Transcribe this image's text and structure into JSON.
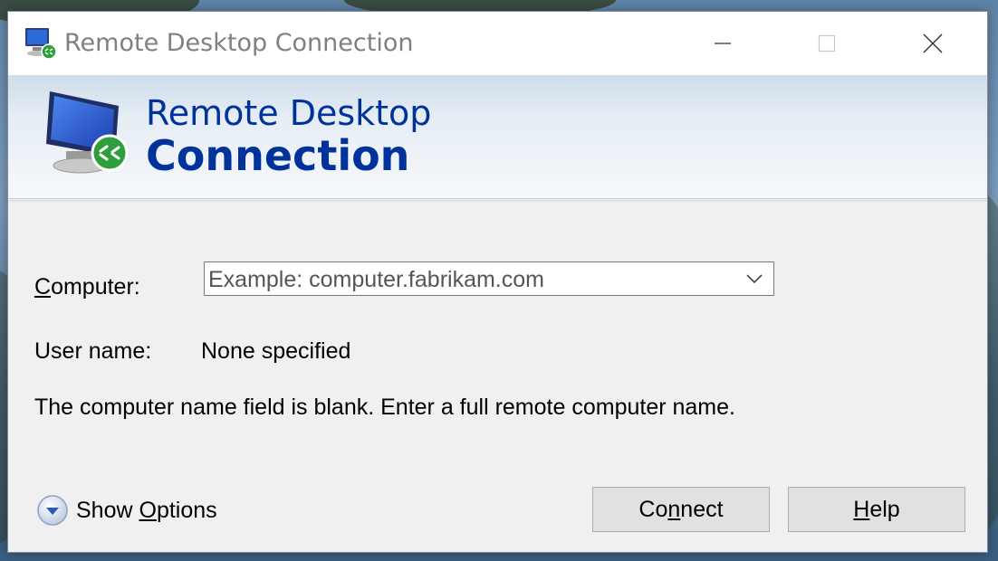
{
  "window": {
    "title": "Remote Desktop Connection"
  },
  "banner": {
    "line1": "Remote Desktop",
    "line2": "Connection"
  },
  "form": {
    "computer_label_first": "C",
    "computer_label_rest": "omputer:",
    "computer_placeholder": "Example: computer.fabrikam.com",
    "username_label": "User name:",
    "username_value": "None specified",
    "message": "The computer name field is blank. Enter a full remote computer name."
  },
  "actions": {
    "show_options_pre": "Show ",
    "show_options_u": "O",
    "show_options_post": "ptions",
    "connect_pre": "Co",
    "connect_u": "n",
    "connect_post": "nect",
    "help_u": "H",
    "help_post": "elp"
  },
  "icons": [
    "remote-desktop-icon",
    "minimize-icon",
    "maximize-icon",
    "close-icon",
    "chevron-down-icon",
    "expand-circle-icon"
  ],
  "colors": {
    "banner_text": "#003399",
    "window_bg": "#f0f0f0",
    "button_bg": "#e1e1e1"
  }
}
